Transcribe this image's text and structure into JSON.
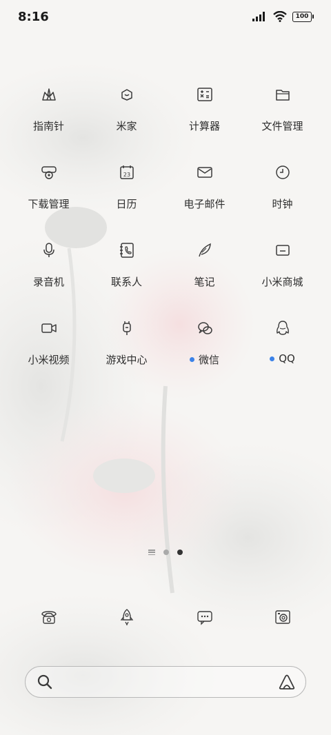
{
  "status_bar": {
    "time": "8:16",
    "battery": "100",
    "icons": [
      "signal-icon",
      "wifi-icon",
      "battery-icon"
    ]
  },
  "apps": [
    {
      "label": "指南针",
      "icon": "compass-icon",
      "dot": false
    },
    {
      "label": "米家",
      "icon": "mijia-home-icon",
      "dot": false
    },
    {
      "label": "计算器",
      "icon": "calculator-icon",
      "dot": false
    },
    {
      "label": "文件管理",
      "icon": "folder-icon",
      "dot": false
    },
    {
      "label": "下载管理",
      "icon": "download-icon",
      "dot": false
    },
    {
      "label": "日历",
      "icon": "calendar-icon",
      "dot": false,
      "icon_text": "23"
    },
    {
      "label": "电子邮件",
      "icon": "mail-icon",
      "dot": false
    },
    {
      "label": "时钟",
      "icon": "clock-icon",
      "dot": false
    },
    {
      "label": "录音机",
      "icon": "microphone-icon",
      "dot": false
    },
    {
      "label": "联系人",
      "icon": "contacts-icon",
      "dot": false
    },
    {
      "label": "笔记",
      "icon": "notes-feather-icon",
      "dot": false
    },
    {
      "label": "小米商城",
      "icon": "mi-store-icon",
      "dot": false
    },
    {
      "label": "小米视频",
      "icon": "video-camera-icon",
      "dot": false
    },
    {
      "label": "游戏中心",
      "icon": "game-center-icon",
      "dot": false
    },
    {
      "label": "微信",
      "icon": "wechat-icon",
      "dot": true
    },
    {
      "label": "QQ",
      "icon": "qq-penguin-icon",
      "dot": true
    }
  ],
  "pager": {
    "pages": 2,
    "active": 2
  },
  "dock": [
    {
      "icon": "phone-icon"
    },
    {
      "icon": "rocket-security-icon"
    },
    {
      "icon": "messages-icon"
    },
    {
      "icon": "camera-icon"
    }
  ],
  "search": {
    "placeholder": "",
    "value": "",
    "search_icon": "search-icon",
    "assistant_icon": "xiaoai-assistant-icon"
  },
  "colors": {
    "badge_dot": "#3b82e8",
    "icon_stroke": "#3a3a3a",
    "text": "#2e2e2e"
  }
}
